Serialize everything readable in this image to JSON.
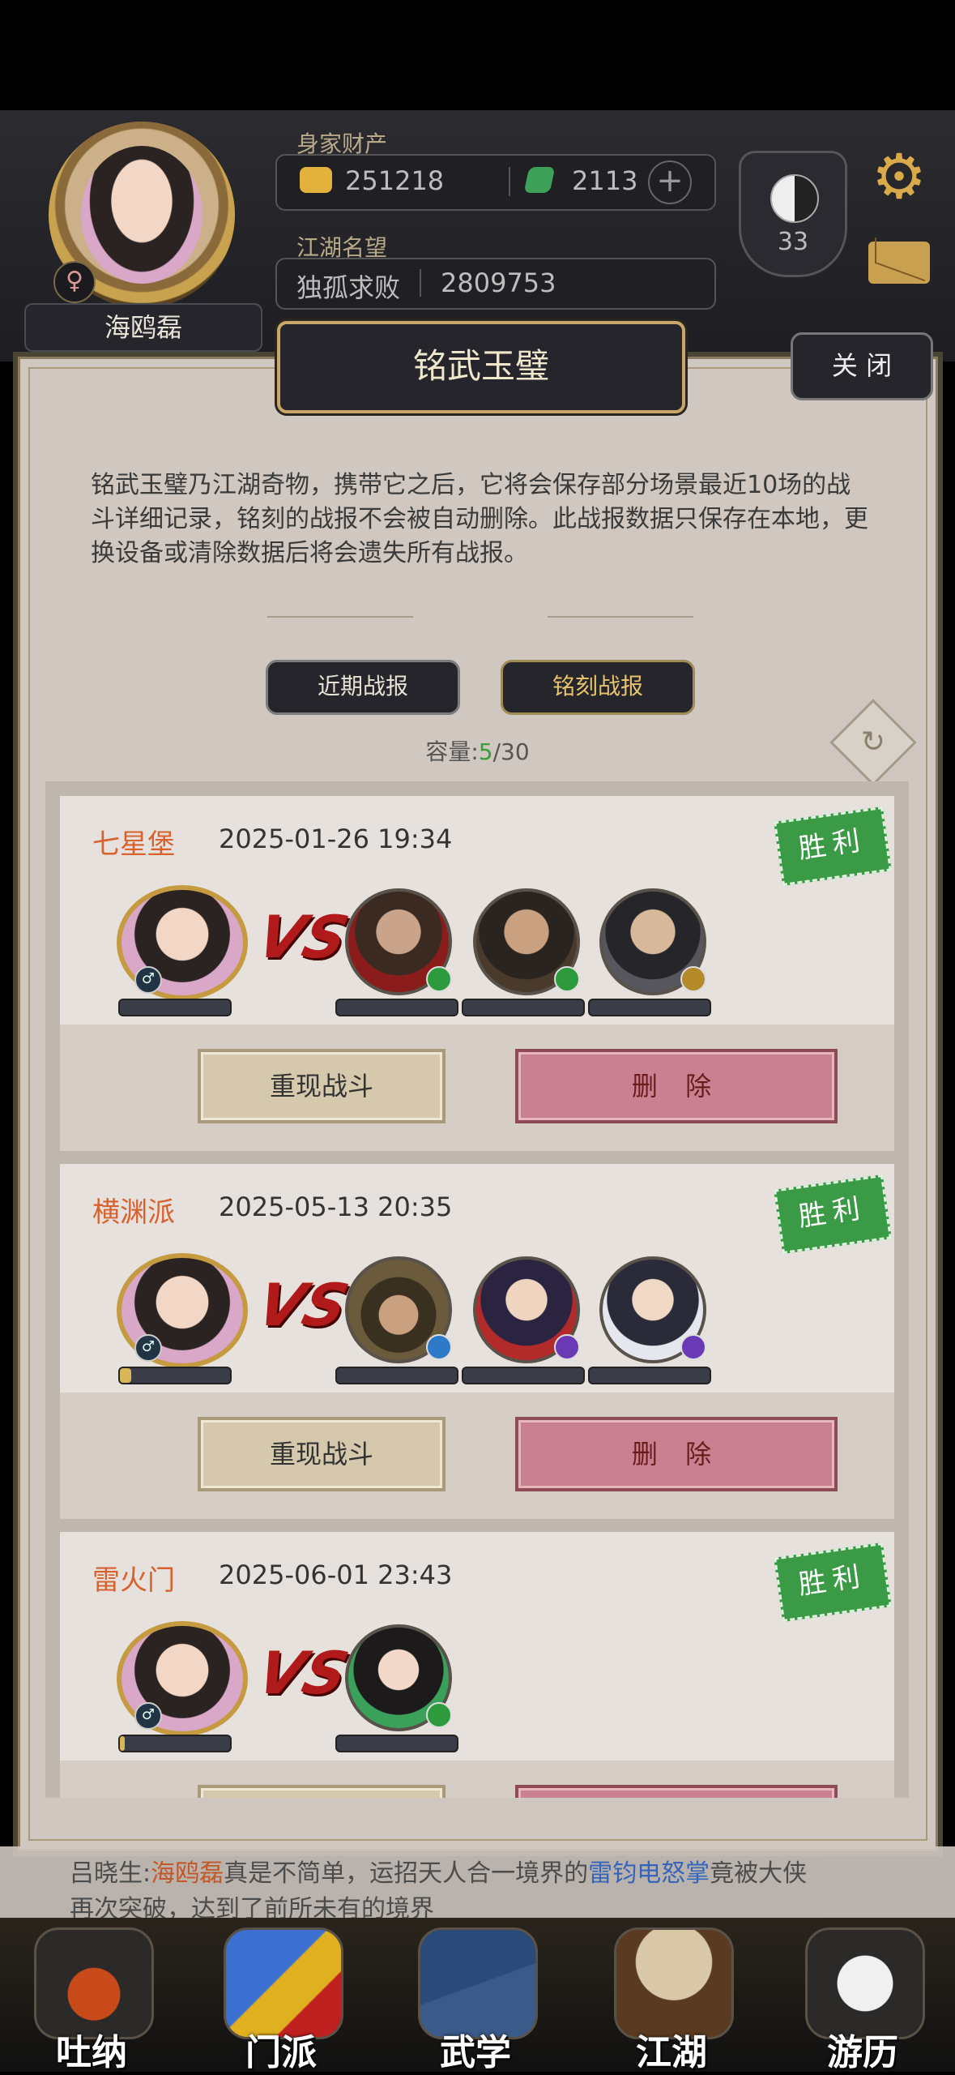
{
  "player": {
    "name": "海鸥磊",
    "wealth_label": "身家财产",
    "gold": "251218",
    "jade": "2113",
    "reputation_label": "江湖名望",
    "title": "独孤求败",
    "reputation": "2809753",
    "level": "33"
  },
  "panel": {
    "title": "铭武玉璧",
    "close_label": "关 闭",
    "description": "铭武玉璧乃江湖奇物，携带它之后，它将会保存部分场景最近10场的战斗详细记录，铭刻的战报不会被自动删除。此战报数据只保存在本地，更换设备或清除数据后将会遗失所有战报。",
    "tabs": [
      "近期战报",
      "铭刻战报"
    ],
    "capacity_label": "容量:",
    "capacity_current": "5",
    "capacity_max": "/30"
  },
  "records": [
    {
      "place": "七星堡",
      "time": "2025-01-26 19:34",
      "result": "胜利",
      "replay_label": "重现战斗",
      "delete_label": "删 除"
    },
    {
      "place": "横渊派",
      "time": "2025-05-13 20:35",
      "result": "胜利",
      "replay_label": "重现战斗",
      "delete_label": "删 除"
    },
    {
      "place": "雷火门",
      "time": "2025-06-01 23:43",
      "result": "胜利"
    }
  ],
  "vs_label": "VS",
  "chat": {
    "prefix": "吕晓生:",
    "name": "海鸥磊",
    "mid": "真是不简单，运招天人合一境界的",
    "skill": "雷钧电怒掌",
    "suffix": "竟被大侠",
    "line2": "再次突破，达到了前所未有的境界"
  },
  "nav": [
    "吐纳",
    "门派",
    "武学",
    "江湖",
    "游历"
  ],
  "colors": {
    "win_stamp": "#3a9a46",
    "place_text": "#d8622e",
    "delete_button": "#c98090"
  }
}
